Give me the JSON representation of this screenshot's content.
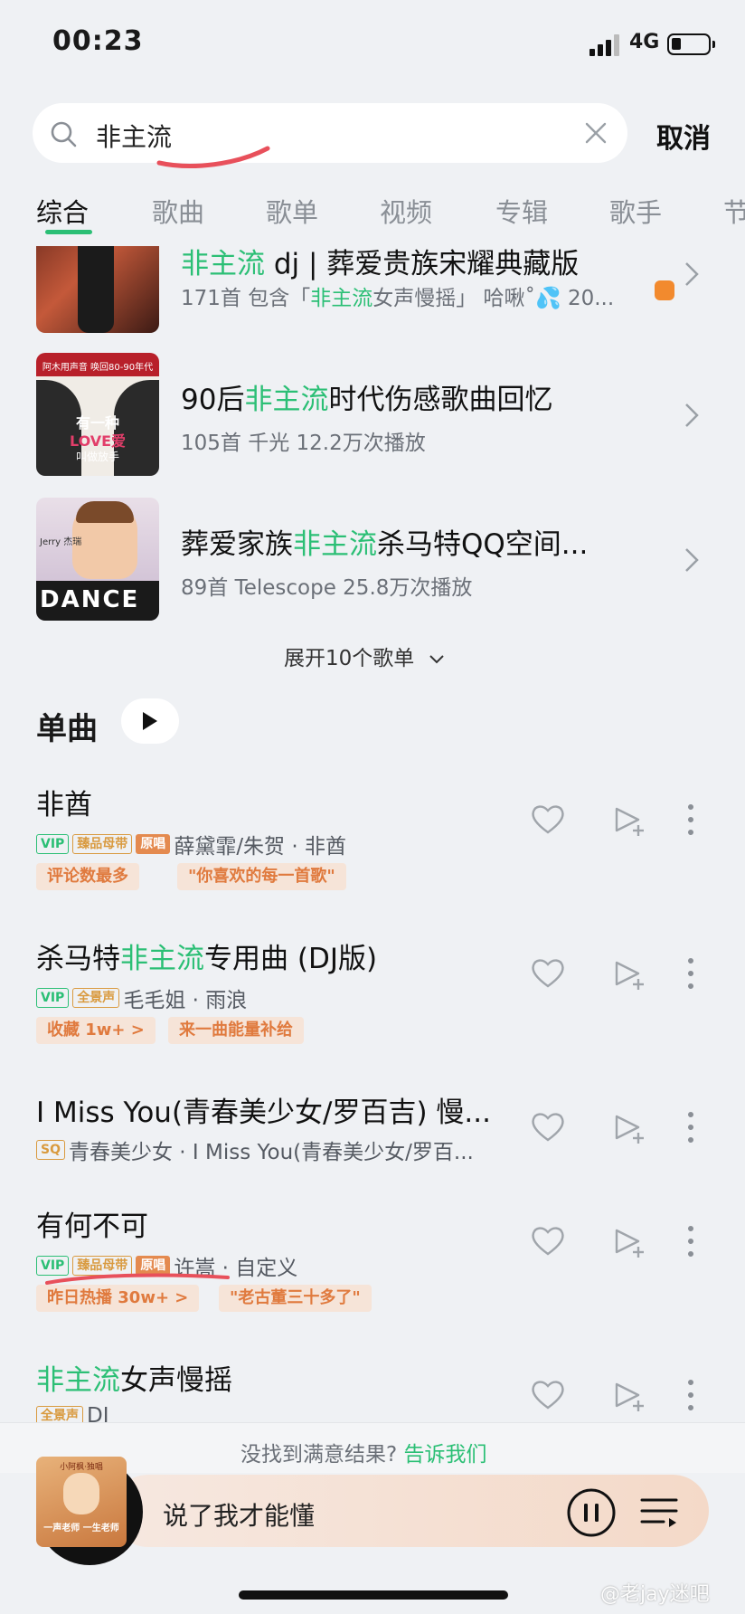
{
  "status_bar": {
    "time": "00:23",
    "network": "4G"
  },
  "search": {
    "query": "非主流",
    "cancel_label": "取消"
  },
  "tabs": [
    "综合",
    "歌曲",
    "歌单",
    "视频",
    "专辑",
    "歌手",
    "节"
  ],
  "playlists": [
    {
      "title_prefix": "非主流",
      "title_rest": " dj | 葬爱贵族宋耀典藏版",
      "meta_a": "171首  包含「",
      "meta_hl": "非主流",
      "meta_b": "女声慢摇」 哈啾˚💦 20..."
    },
    {
      "title_prefix": "90后",
      "title_hl": "非主流",
      "title_rest": "时代伤感歌曲回忆",
      "meta": "105首  千光  12.2万次播放",
      "cover_line1": "有一种",
      "cover_line2": "LOVE爱",
      "cover_line3": "叫做放手",
      "cover_top": "阿木用声音 唤回80-90年代"
    },
    {
      "title_prefix": "葬爱家族",
      "title_hl": "非主流",
      "title_rest": "杀马特QQ空间...",
      "meta": "89首  Telescope  25.8万次播放",
      "cover_text": "DANCE",
      "cover_small": "Jerry 杰瑞"
    }
  ],
  "expand_label": "展开10个歌单",
  "singles": {
    "title": "单曲",
    "songs": [
      {
        "title_a": "非酋",
        "title_hl": "",
        "title_b": "",
        "badges": [
          "VIP",
          "臻品母带",
          "原唱"
        ],
        "meta": "薛黛霏/朱贺 · 非酋",
        "tags": [
          "评论数最多",
          "\"你喜欢的每一首歌\""
        ]
      },
      {
        "title_a": "杀马特",
        "title_hl": "非主流",
        "title_b": "专用曲 (DJ版)",
        "badges": [
          "VIP",
          "全景声"
        ],
        "meta": "毛毛姐 · 雨浪",
        "tags": [
          "收藏 1w+ >",
          "来一曲能量补给"
        ]
      },
      {
        "title_a": "I Miss You(青春美少女/罗百吉) 慢...",
        "title_hl": "",
        "title_b": "",
        "badges": [
          "SQ"
        ],
        "meta": "青春美少女 · I Miss You(青春美少女/罗百...",
        "tags": []
      },
      {
        "title_a": "有何不可",
        "title_hl": "",
        "title_b": "",
        "badges": [
          "VIP",
          "臻品母带",
          "原唱"
        ],
        "meta": "许嵩 · 自定义",
        "tags": [
          "昨日热播 30w+ >",
          "\"老古董三十多了\""
        ]
      },
      {
        "title_a": "",
        "title_hl": "非主流",
        "title_b": "女声慢摇",
        "badges": [
          "全景声"
        ],
        "meta": "DJ",
        "tags": []
      }
    ]
  },
  "feedback": {
    "text": "没找到满意结果?",
    "link": "告诉我们"
  },
  "player": {
    "now_playing": "说了我才能懂",
    "album_text_top": "小阿枫·独唱",
    "album_text": "一声老师 一生老师"
  },
  "watermark": "@老jay迷吧",
  "colors": {
    "accent": "#2bbf75",
    "tag_bg": "#f6e4d8",
    "tag_text": "#e07a3e"
  }
}
